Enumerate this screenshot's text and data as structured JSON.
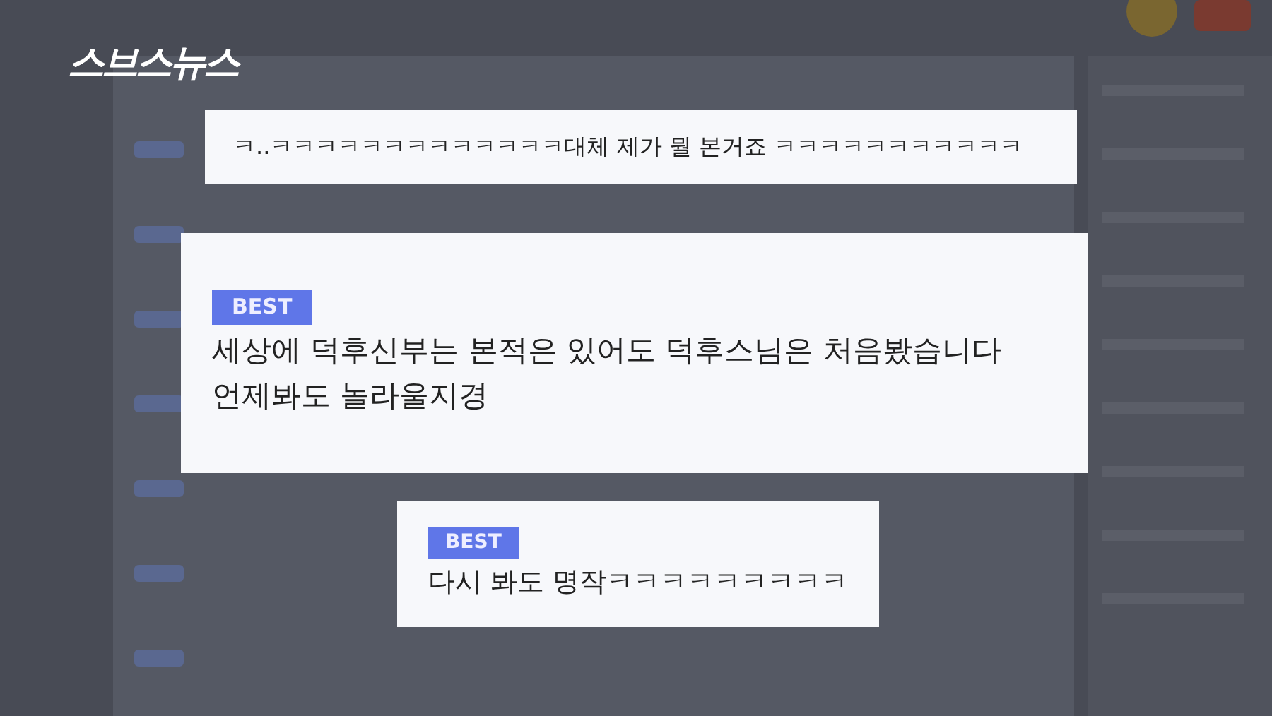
{
  "logo": {
    "text": "스브스뉴스"
  },
  "comments": [
    {
      "lines": [
        "ㅋ..ㅋㅋㅋㅋㅋㅋㅋㅋㅋㅋㅋㅋㅋ대체 제가 뭘 본거죠 ㅋㅋㅋㅋㅋㅋㅋㅋㅋㅋㅋ"
      ]
    },
    {
      "badge": "BEST",
      "lines": [
        "세상에 덕후신부는 본적은 있어도 덕후스님은 처음봤습니다",
        "언제봐도 놀라울지경"
      ]
    },
    {
      "badge": "BEST",
      "lines": [
        "다시 봐도 명작ㅋㅋㅋㅋㅋㅋㅋㅋㅋ"
      ]
    }
  ]
}
